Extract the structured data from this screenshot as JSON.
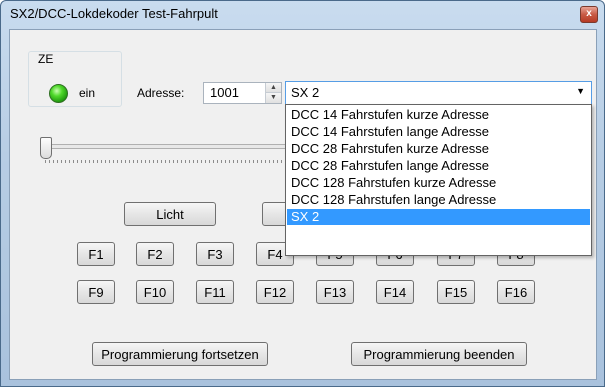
{
  "window": {
    "title": "SX2/DCC-Lokdekoder Test-Fahrpult",
    "close_glyph": "x"
  },
  "ze": {
    "group_label": "ZE",
    "status_text": "ein"
  },
  "address": {
    "label": "Adresse:",
    "value": "1001"
  },
  "protocol": {
    "selected": "SX 2",
    "options": [
      "DCC 14 Fahrstufen kurze Adresse",
      "DCC 14 Fahrstufen lange Adresse",
      "DCC 28 Fahrstufen kurze Adresse",
      "DCC 28 Fahrstufen lange Adresse",
      "DCC 128 Fahrstufen kurze Adresse",
      "DCC 128 Fahrstufen lange Adresse",
      "SX 2"
    ]
  },
  "speed_slider": {
    "level": 0
  },
  "buttons": {
    "light": "Licht",
    "functions_row1": [
      "F1",
      "F2",
      "F3",
      "F4",
      "F5",
      "F6",
      "F7",
      "F8"
    ],
    "functions_row2": [
      "F9",
      "F10",
      "F11",
      "F12",
      "F13",
      "F14",
      "F15",
      "F16"
    ],
    "prog_continue": "Programmierung fortsetzen",
    "prog_end": "Programmierung beenden"
  },
  "icons": {
    "spin_up": "triangle-up-icon",
    "spin_down": "triangle-down-icon",
    "combo_arrow": "chevron-down-icon"
  },
  "colors": {
    "selection": "#3399ff",
    "led": "#4fd82a",
    "focus_border": "#569de5"
  }
}
